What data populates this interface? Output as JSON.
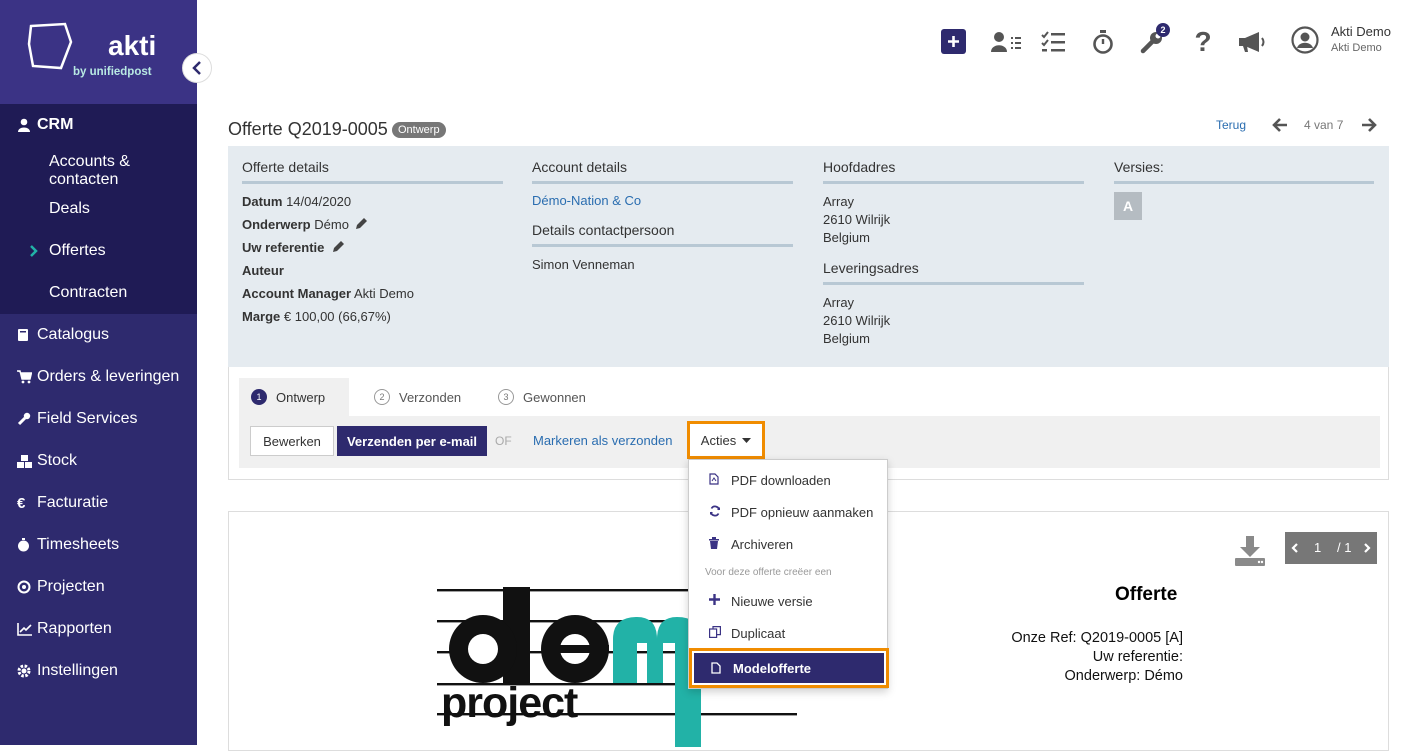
{
  "brand": {
    "name": "akti",
    "sub": "by unifiedpost"
  },
  "sidebar": {
    "crm_label": "CRM",
    "crm_items": [
      {
        "label": "Accounts & contacten"
      },
      {
        "label": "Deals"
      },
      {
        "label": "Offertes",
        "active": true
      },
      {
        "label": "Contracten"
      }
    ],
    "items": [
      {
        "label": "Catalogus",
        "icon": "book-icon"
      },
      {
        "label": "Orders & leveringen",
        "icon": "cart-icon"
      },
      {
        "label": "Field Services",
        "icon": "wrench-icon"
      },
      {
        "label": "Stock",
        "icon": "boxes-icon"
      },
      {
        "label": "Facturatie",
        "icon": "euro-icon"
      },
      {
        "label": "Timesheets",
        "icon": "stopwatch-icon"
      },
      {
        "label": "Projecten",
        "icon": "target-icon"
      },
      {
        "label": "Rapporten",
        "icon": "chart-icon"
      },
      {
        "label": "Instellingen",
        "icon": "gear-icon"
      }
    ]
  },
  "topbar": {
    "badge": "2",
    "user_name": "Akti Demo",
    "user_company": "Akti Demo"
  },
  "header": {
    "title": "Offerte Q2019-0005",
    "status": "Ontwerp",
    "back": "Terug",
    "pager": "4 van 7"
  },
  "details": {
    "offer": {
      "head": "Offerte details",
      "rows": [
        {
          "k": "Datum",
          "v": "14/04/2020"
        },
        {
          "k": "Onderwerp",
          "v": "Démo"
        },
        {
          "k": "Uw referentie",
          "v": ""
        },
        {
          "k": "Auteur",
          "v": ""
        },
        {
          "k": "Account Manager",
          "v": "Akti Demo"
        },
        {
          "k": "Marge",
          "v": "€ 100,00 (66,67%)"
        }
      ]
    },
    "account": {
      "head": "Account details",
      "link": "Démo-Nation & Co",
      "contact_head": "Details contactpersoon",
      "contact": "Simon Venneman"
    },
    "address": {
      "head": "Hoofdadres",
      "lines": [
        "Array",
        "2610 Wilrijk",
        "Belgium"
      ],
      "delivery_head": "Leveringsadres",
      "delivery_lines": [
        "Array",
        "2610 Wilrijk",
        "Belgium"
      ]
    },
    "versions": {
      "head": "Versies:",
      "items": [
        "A"
      ]
    }
  },
  "steps": [
    {
      "num": "1",
      "label": "Ontwerp"
    },
    {
      "num": "2",
      "label": "Verzonden"
    },
    {
      "num": "3",
      "label": "Gewonnen"
    }
  ],
  "actions": {
    "edit": "Bewerken",
    "send": "Verzenden per e-mail",
    "or": "OF",
    "mark": "Markeren als verzonden",
    "acties": "Acties"
  },
  "menu": {
    "items": [
      {
        "label": "PDF downloaden",
        "icon": "file-pdf-icon"
      },
      {
        "label": "PDF opnieuw aanmaken",
        "icon": "refresh-icon"
      },
      {
        "label": "Archiveren",
        "icon": "trash-icon"
      }
    ],
    "section": "Voor deze offerte creëer een",
    "create": [
      {
        "label": "Nieuwe versie",
        "icon": "plus-icon"
      },
      {
        "label": "Duplicaat",
        "icon": "copy-icon"
      },
      {
        "label": "Modelofferte",
        "icon": "file-icon"
      }
    ]
  },
  "preview": {
    "page": "1",
    "total": "/ 1",
    "doc_title": "Offerte",
    "ref": "Onze Ref: Q2019-0005 [A]",
    "uref": "Uw referentie:",
    "subject": "Onderwerp: Démo",
    "logo_word": "project"
  },
  "colors": {
    "primary": "#2e2a6e",
    "highlight": "#f08c00",
    "accent": "#22b2a7",
    "link": "#2a6db0"
  }
}
